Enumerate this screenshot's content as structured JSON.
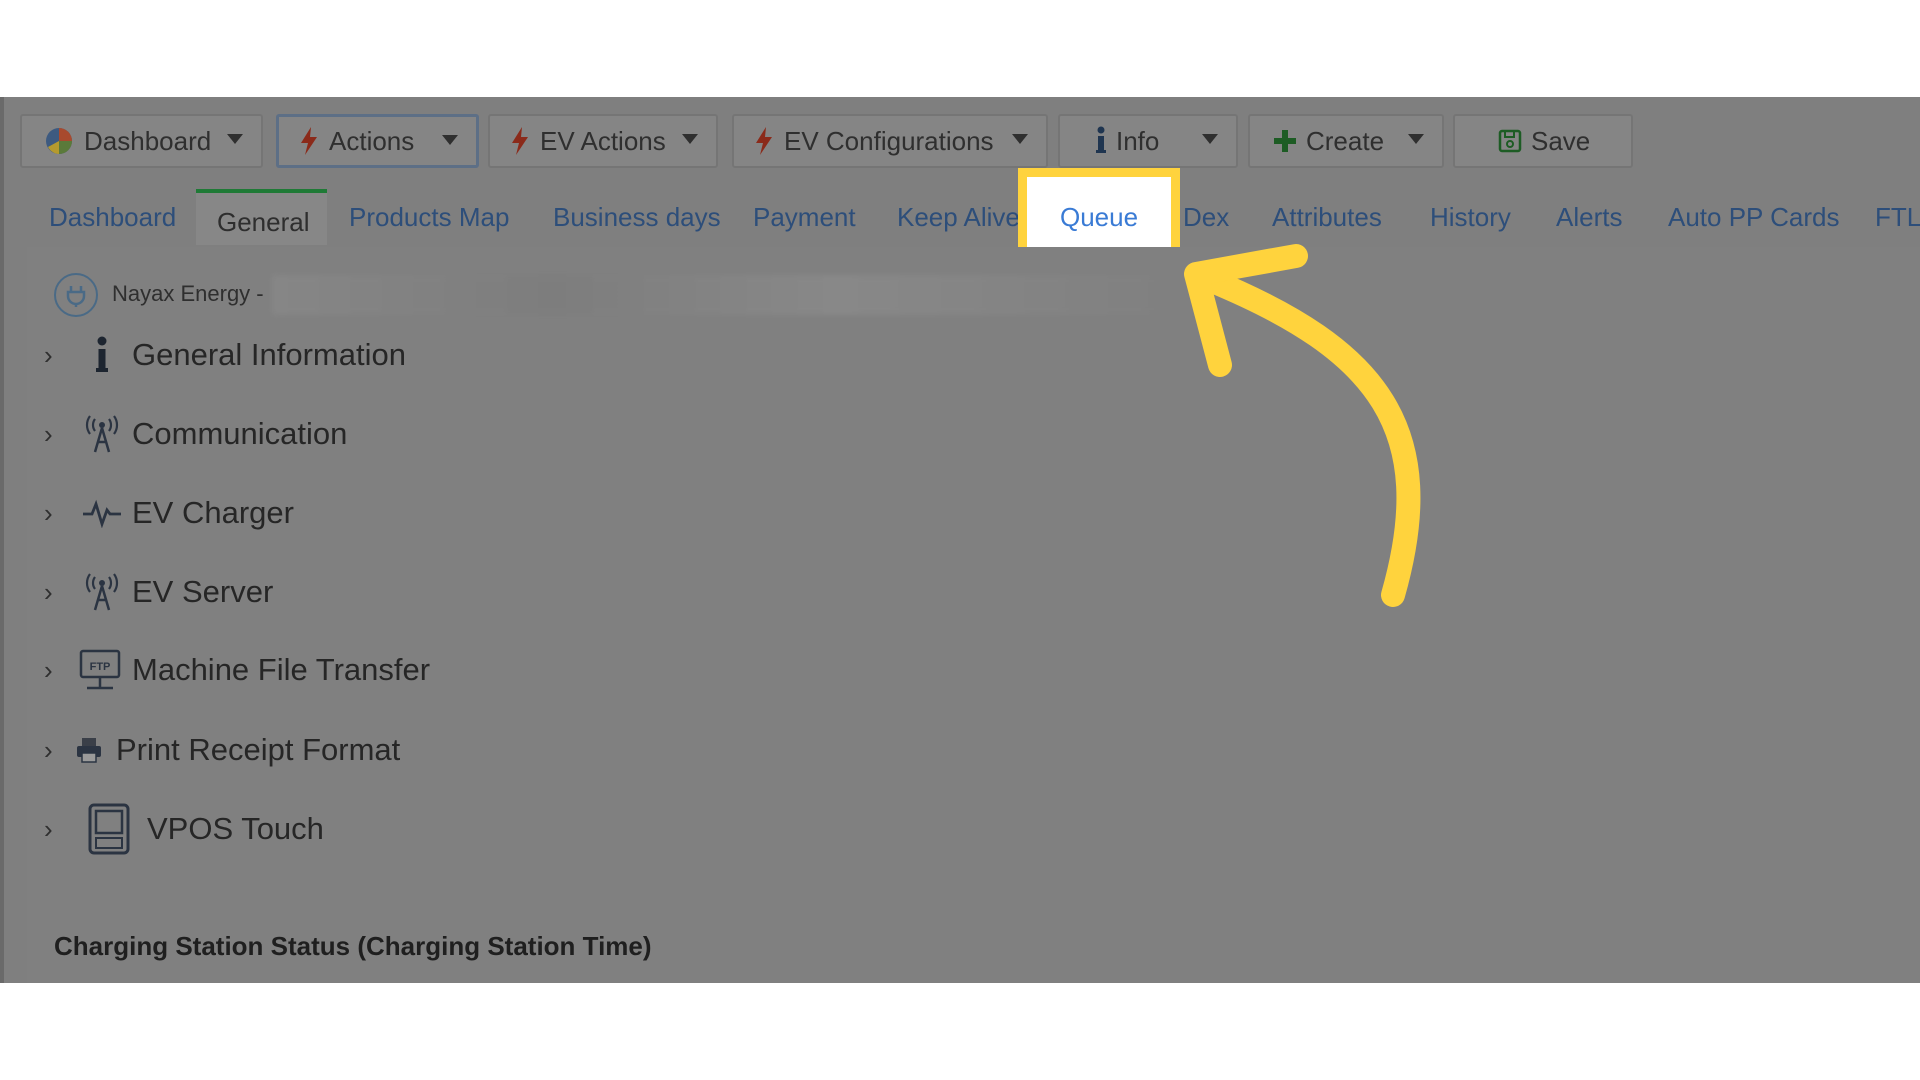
{
  "toolbar": {
    "dashboard_label": "Dashboard",
    "actions_label": "Actions",
    "ev_actions_label": "EV Actions",
    "ev_configurations_label": "EV Configurations",
    "info_label": "Info",
    "create_label": "Create",
    "save_label": "Save"
  },
  "tabs": {
    "dashboard": "Dashboard",
    "general": "General",
    "products_map": "Products Map",
    "business_days": "Business days",
    "payment": "Payment",
    "keep_alive": "Keep Alive",
    "queue": "Queue",
    "dex": "Dex",
    "attributes": "Attributes",
    "history": "History",
    "alerts": "Alerts",
    "auto_pp_cards": "Auto PP Cards",
    "ftl": "FTL",
    "selected": "General",
    "highlighted": "Queue"
  },
  "station": {
    "name": "Nayax Energy -"
  },
  "sections": [
    {
      "label": "General Information",
      "icon": "info-icon"
    },
    {
      "label": "Communication",
      "icon": "antenna-icon"
    },
    {
      "label": "EV Charger",
      "icon": "pulse-icon"
    },
    {
      "label": "EV Server",
      "icon": "antenna-icon"
    },
    {
      "label": "Machine File Transfer",
      "icon": "ftp-icon"
    },
    {
      "label": "Print Receipt Format",
      "icon": "printer-icon"
    },
    {
      "label": "VPOS Touch",
      "icon": "terminal-icon"
    }
  ],
  "status_title": "Charging Station Status (Charging Station Time)",
  "colors": {
    "highlight": "#ffd33d",
    "overlay": "#7f7f7f",
    "tab_link": "#2d4e7a",
    "queue_link": "#3a7bd5",
    "active_tab_bar": "#1f7a36"
  }
}
